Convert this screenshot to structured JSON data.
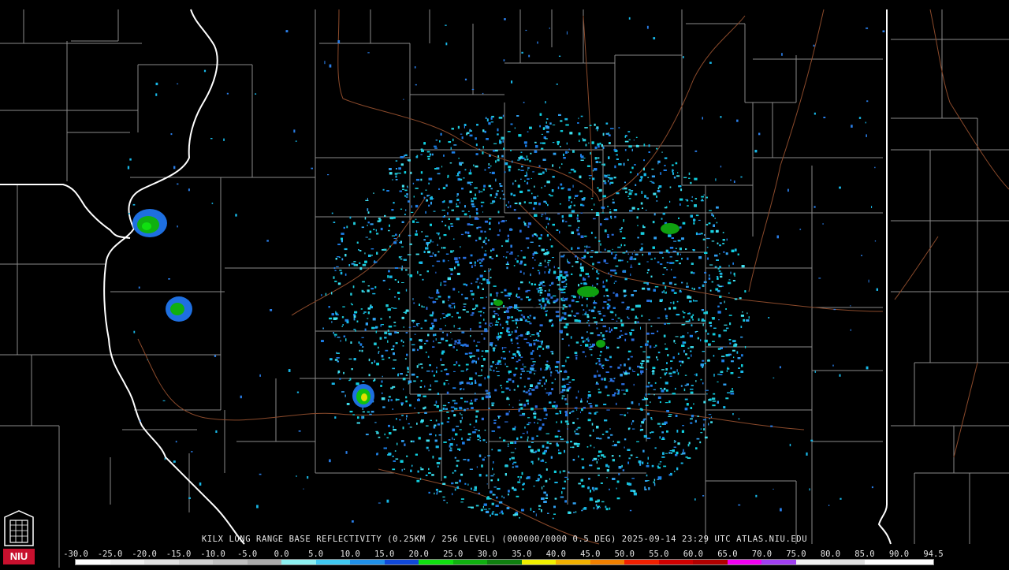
{
  "product": {
    "caption": "KILX LONG RANGE BASE REFLECTIVITY (0.25KM / 256 LEVEL) (000000/0000 0.5 DEG) 2025-09-14 23:29 UTC  ATLAS.NIU.EDU"
  },
  "logo": {
    "text": "NIU",
    "color": "#c8102e"
  },
  "color_scale": {
    "labels": [
      "-30.0",
      "-25.0",
      "-20.0",
      "-15.0",
      "-10.0",
      "-5.0",
      "0.0",
      "5.0",
      "10.0",
      "15.0",
      "20.0",
      "25.0",
      "30.0",
      "35.0",
      "40.0",
      "45.0",
      "50.0",
      "55.0",
      "60.0",
      "65.0",
      "70.0",
      "75.0",
      "80.0",
      "85.0",
      "90.0",
      "94.5"
    ],
    "colors": [
      "#ffffff",
      "#f0f0f0",
      "#e0e0e0",
      "#d0d0d0",
      "#c0c0c0",
      "#aaaaaa",
      "#8cf0f0",
      "#40c8f0",
      "#2090e8",
      "#1048d8",
      "#10e010",
      "#10b010",
      "#108010",
      "#f0f000",
      "#f0b000",
      "#f08000",
      "#f02000",
      "#d00000",
      "#b00000",
      "#f000f0",
      "#a040f0",
      "#f0f0f0",
      "#e0e0e0",
      "#ffffff",
      "#ffffff"
    ]
  },
  "echoes": [
    {
      "name": "echo-cell-northwest",
      "intensity": "green"
    },
    {
      "name": "echo-cell-west",
      "intensity": "green"
    },
    {
      "name": "echo-cell-southwest",
      "intensity": "yellow"
    },
    {
      "name": "echo-cell-east",
      "intensity": "green"
    }
  ]
}
